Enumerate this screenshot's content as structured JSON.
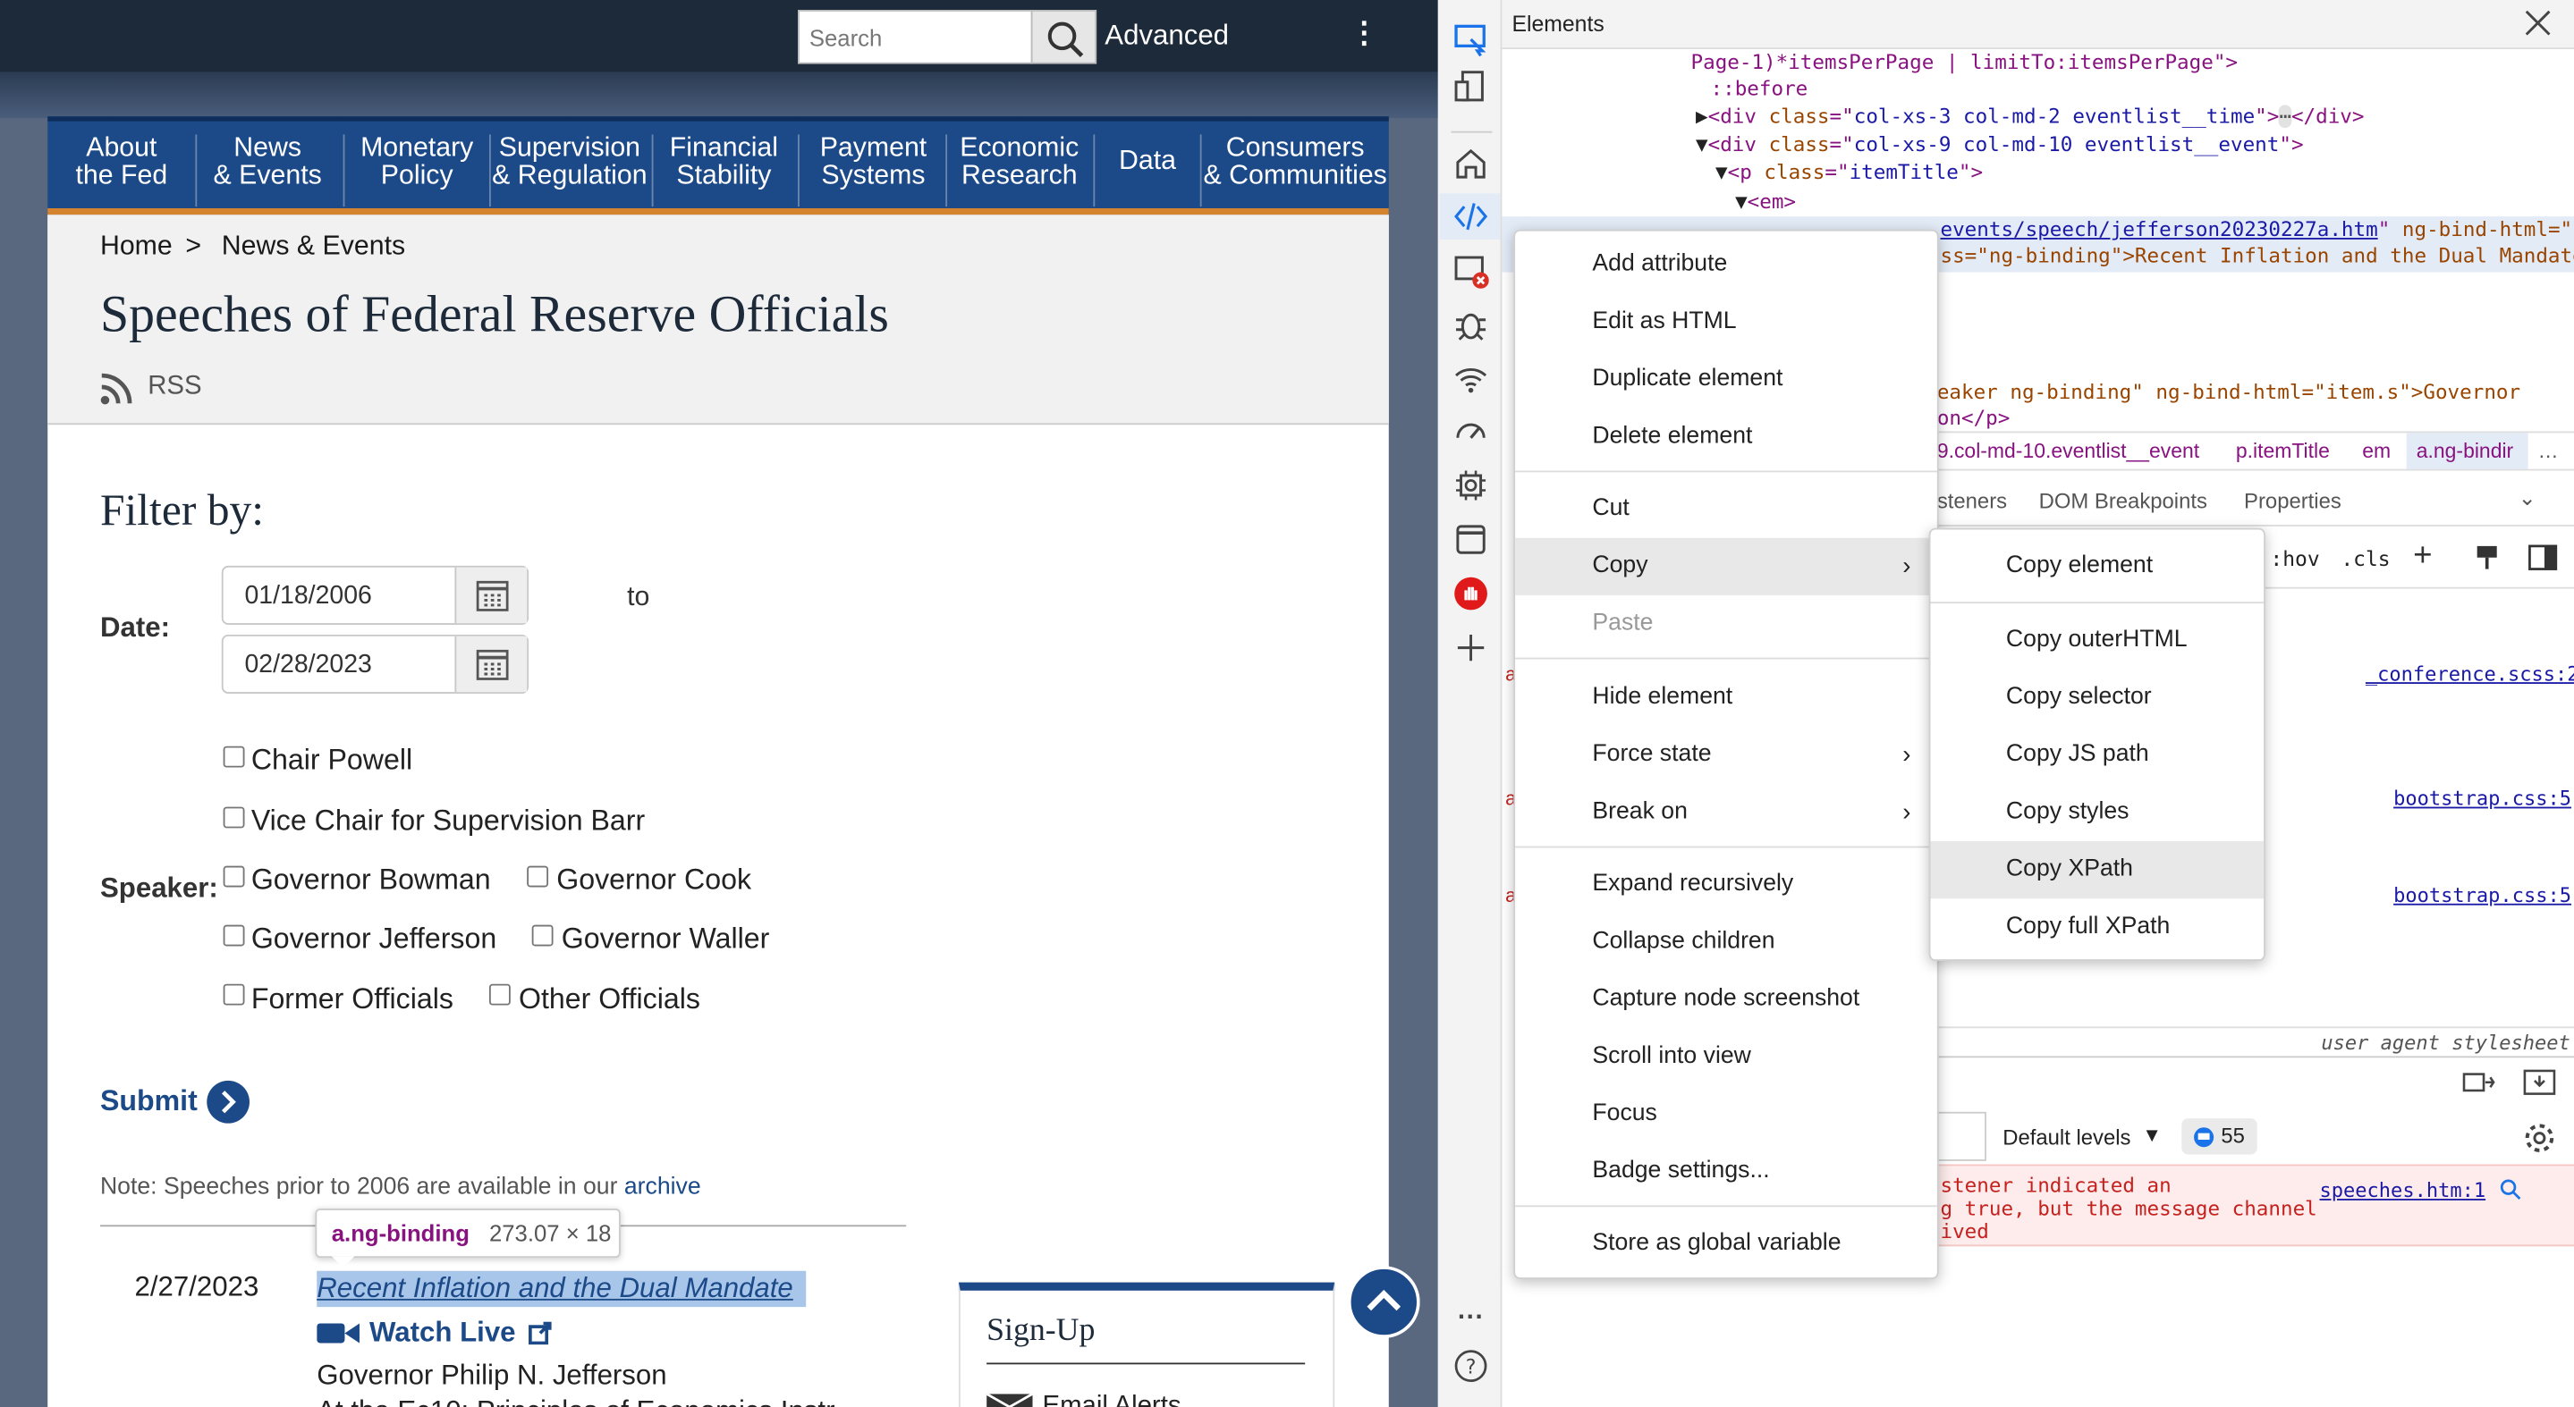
{
  "page": {
    "search": {
      "placeholder": "Search",
      "advanced": "Advanced"
    },
    "nav": [
      {
        "l1": "About",
        "l2": "the Fed"
      },
      {
        "l1": "News",
        "l2": "& Events"
      },
      {
        "l1": "Monetary",
        "l2": "Policy"
      },
      {
        "l1": "Supervision",
        "l2": "& Regulation"
      },
      {
        "l1": "Financial",
        "l2": "Stability"
      },
      {
        "l1": "Payment",
        "l2": "Systems"
      },
      {
        "l1": "Economic",
        "l2": "Research"
      },
      {
        "l1": "Data",
        "l2": ""
      },
      {
        "l1": "Consumers",
        "l2": "& Communities"
      }
    ],
    "breadcrumb": {
      "home": "Home",
      "sep": ">",
      "current": "News & Events"
    },
    "title": "Speeches of Federal Reserve Officials",
    "rss": "RSS",
    "filter": {
      "heading": "Filter by:",
      "date_label": "Date:",
      "from": "01/18/2006",
      "to_word": "to",
      "to": "02/28/2023",
      "speaker_label": "Speaker:",
      "speakers": [
        "Chair Powell",
        "Vice Chair for Supervision Barr",
        "Governor Bowman",
        "Governor Cook",
        "Governor Jefferson",
        "Governor Waller",
        "Former Officials",
        "Other Officials"
      ],
      "submit": "Submit"
    },
    "note": {
      "text": "Note: Speeches prior to 2006 are available in our ",
      "link": "archive"
    },
    "tooltip": {
      "sel": "a.ng-binding",
      "dims": "273.07 × 18"
    },
    "speech": {
      "date": "2/27/2023",
      "title": "Recent Inflation and the Dual Mandate",
      "watch": "Watch Live",
      "speaker": "Governor Philip N. Jefferson",
      "partial": "At the Ec10: Principles of Economics Instr"
    },
    "signup": {
      "title": "Sign-Up",
      "email": "Email Alerts"
    }
  },
  "devtools": {
    "panel_title": "Elements",
    "code": [
      "Page-1)*itemsPerPage | limitTo:itemsPerPage\">",
      "::before",
      "col-xs-3 col-md-2 eventlist__time",
      "col-xs-9 col-md-10 eventlist__event",
      "itemTitle",
      "<em>",
      "events/speech/jefferson20230227a.htm",
      "ng-bind-html=\"i",
      "ss=\"ng-binding\">Recent Inflation and the Dual Mandate",
      "eaker ng-binding\" ng-bind-html=\"item.s\">Governor",
      "on</p>"
    ],
    "crumbs": [
      "9.col-md-10.eventlist__event",
      "p.itemTitle",
      "em",
      "a.ng-bindir",
      "…"
    ],
    "tabs": [
      "steners",
      "DOM Breakpoints",
      "Properties"
    ],
    "styles_tools": [
      ":hov",
      ".cls"
    ],
    "css_links": [
      "_conference.scss:2",
      "bootstrap.css:5",
      "bootstrap.css:5"
    ],
    "ua": "user agent stylesheet",
    "console": {
      "levels": "Default levels",
      "count": "55",
      "msg1": "stener indicated an",
      "msg2": "g true, but the message channel",
      "msg3": "ived",
      "link": "speeches.htm:1"
    },
    "menu": [
      "Add attribute",
      "Edit as HTML",
      "Duplicate element",
      "Delete element",
      "Cut",
      "Copy",
      "Paste",
      "Hide element",
      "Force state",
      "Break on",
      "Expand recursively",
      "Collapse children",
      "Capture node screenshot",
      "Scroll into view",
      "Focus",
      "Badge settings...",
      "Store as global variable"
    ],
    "submenu": [
      "Copy element",
      "Copy outerHTML",
      "Copy selector",
      "Copy JS path",
      "Copy styles",
      "Copy XPath",
      "Copy full XPath"
    ],
    "icons": [
      "inspect-icon",
      "device-icon",
      "home-icon",
      "elements-icon",
      "console-error-icon",
      "bug-icon",
      "network-icon",
      "performance-icon",
      "settings-chip-icon",
      "application-icon",
      "stop-hand-icon",
      "plus-icon",
      "more-icon",
      "help-icon"
    ]
  }
}
